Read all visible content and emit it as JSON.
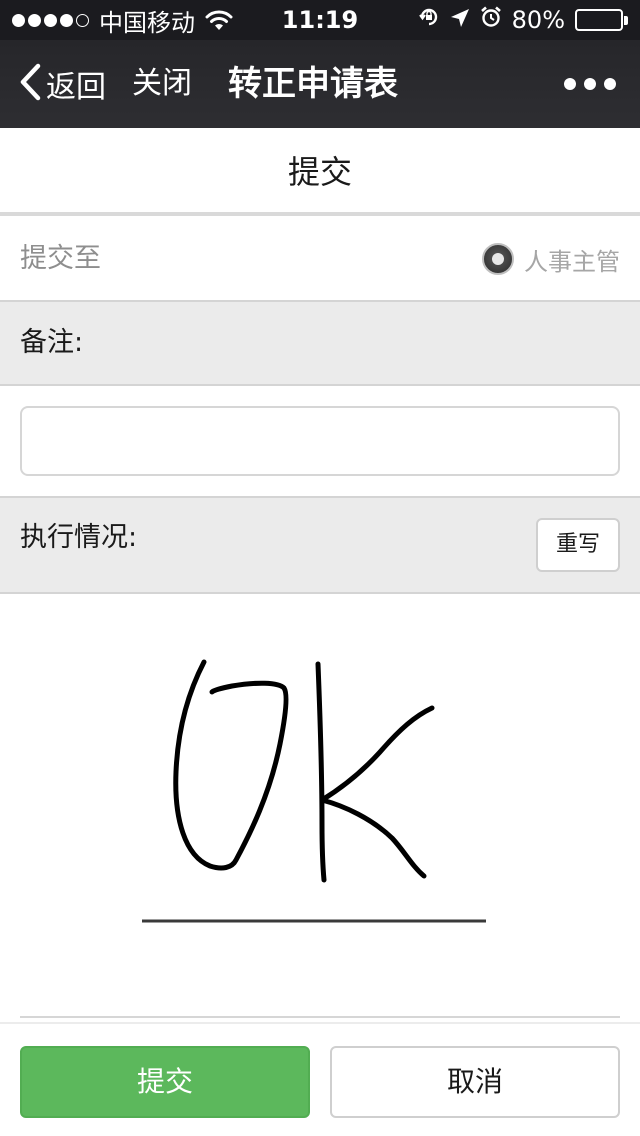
{
  "status_bar": {
    "signal_filled": 4,
    "signal_total": 5,
    "carrier": "中国移动",
    "wifi_icon": "wifi-icon",
    "time": "11:19",
    "icons": [
      "rotation-lock-icon",
      "location-arrow-icon",
      "alarm-icon"
    ],
    "battery_percent_text": "80%",
    "battery_level": 0.8
  },
  "nav": {
    "back_label": "返回",
    "close_label": "关闭",
    "title": "转正申请表",
    "more_icon": "more-dots-icon"
  },
  "form": {
    "header": "提交",
    "submit_to_label": "提交至",
    "submit_to_option": "人事主管",
    "submit_to_selected": true,
    "notes_label": "备注:",
    "notes_value": "",
    "notes_placeholder": "",
    "execution_label": "执行情况:",
    "rewrite_label": "重写",
    "signature_text": "OK"
  },
  "footer": {
    "submit_label": "提交",
    "cancel_label": "取消"
  },
  "colors": {
    "statusbar_bg": "#1b1b1f",
    "navbar_bg": "#2a2a2e",
    "primary_green": "#5cb85c",
    "grey_bar": "#ebebeb"
  }
}
